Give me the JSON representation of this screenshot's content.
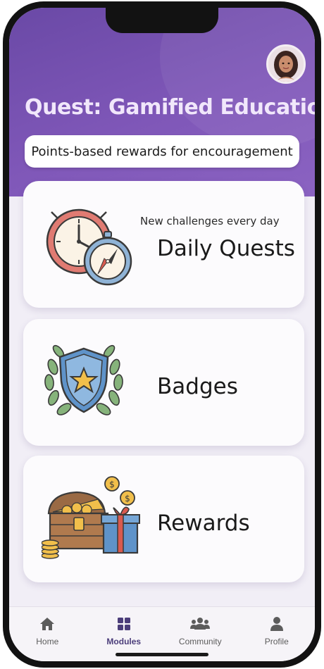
{
  "header": {
    "title": "Quest: Gamified Education",
    "subtitle": "Points-based rewards for encouragement"
  },
  "cards": [
    {
      "title": "Daily Quests",
      "subtitle": "New challenges every day",
      "icon": "clock-compass-icon"
    },
    {
      "title": "Badges",
      "icon": "shield-star-badge-icon"
    },
    {
      "title": "Rewards",
      "icon": "treasure-chest-icon"
    }
  ],
  "tabbar": {
    "items": [
      {
        "label": "Home",
        "icon": "home-icon",
        "active": false
      },
      {
        "label": "Modules",
        "icon": "grid-icon",
        "active": true
      },
      {
        "label": "Community",
        "icon": "people-icon",
        "active": false
      },
      {
        "label": "Profile",
        "icon": "person-icon",
        "active": false
      }
    ]
  },
  "colors": {
    "header_purple": "#7452ae",
    "active_tab": "#4b3d7a",
    "card_bg": "#fcfbfd"
  }
}
